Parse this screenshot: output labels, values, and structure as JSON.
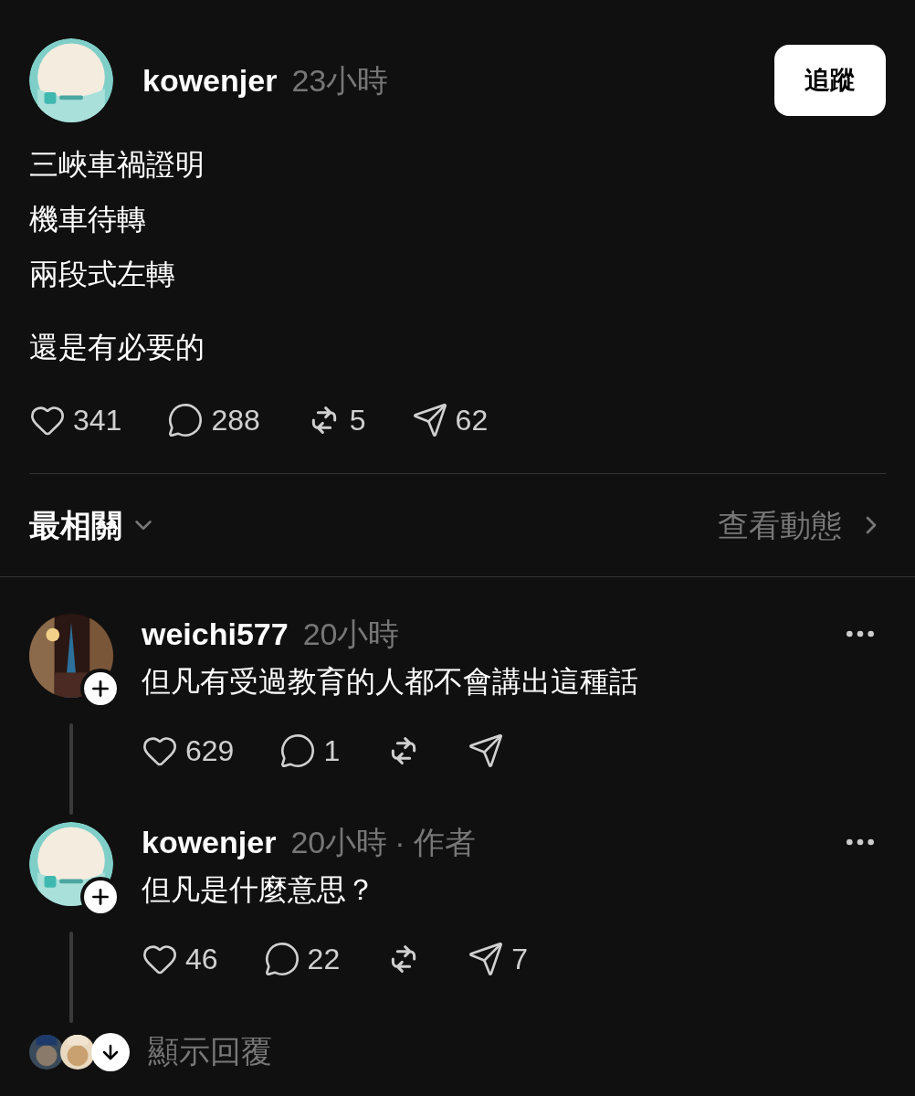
{
  "post": {
    "author": "kowenjer",
    "time": "23小時",
    "follow_button": "追蹤",
    "paragraphs": [
      [
        "三峽車禍證明",
        "機車待轉",
        "兩段式左轉"
      ],
      [
        "還是有必要的"
      ]
    ],
    "stats": [
      {
        "kind": "like",
        "count": "341"
      },
      {
        "kind": "comment",
        "count": "288"
      },
      {
        "kind": "repost",
        "count": "5"
      },
      {
        "kind": "share",
        "count": "62"
      }
    ]
  },
  "sort": {
    "label": "最相關",
    "activity_link": "查看動態"
  },
  "replies": [
    {
      "author": "weichi577",
      "time": "20小時",
      "text": "但凡有受過教育的人都不會講出這種話",
      "stats": [
        {
          "kind": "like",
          "count": "629"
        },
        {
          "kind": "comment",
          "count": "1"
        },
        {
          "kind": "repost"
        },
        {
          "kind": "share"
        }
      ]
    },
    {
      "author": "kowenjer",
      "time": "20小時",
      "tag": "· 作者",
      "text": "但凡是什麼意思？",
      "stats": [
        {
          "kind": "like",
          "count": "46"
        },
        {
          "kind": "comment",
          "count": "22"
        },
        {
          "kind": "repost"
        },
        {
          "kind": "share",
          "count": "7"
        }
      ]
    }
  ],
  "show_replies": "顯示回覆"
}
